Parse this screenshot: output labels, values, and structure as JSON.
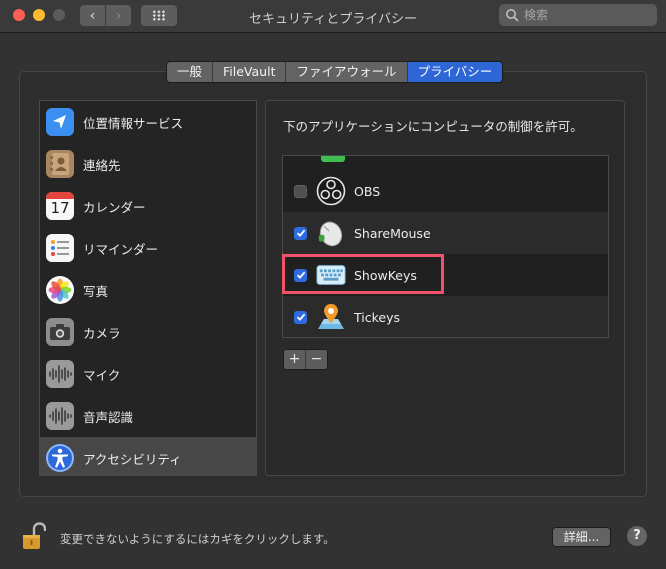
{
  "window": {
    "title": "セキュリティとプライバシー",
    "search_placeholder": "検索"
  },
  "tabs": [
    {
      "label": "一般",
      "active": false
    },
    {
      "label": "FileVault",
      "active": false
    },
    {
      "label": "ファイアウォール",
      "active": false
    },
    {
      "label": "プライバシー",
      "active": true
    }
  ],
  "sidebar": {
    "items": [
      {
        "label": "位置情報サービス",
        "icon": "location-arrow-icon"
      },
      {
        "label": "連絡先",
        "icon": "contacts-book-icon"
      },
      {
        "label": "カレンダー",
        "icon": "calendar-icon",
        "icon_text": "17"
      },
      {
        "label": "リマインダー",
        "icon": "reminders-icon"
      },
      {
        "label": "写真",
        "icon": "photos-flower-icon"
      },
      {
        "label": "カメラ",
        "icon": "camera-icon"
      },
      {
        "label": "マイク",
        "icon": "microphone-waveform-icon"
      },
      {
        "label": "音声認識",
        "icon": "speech-waveform-icon"
      },
      {
        "label": "アクセシビリティ",
        "icon": "accessibility-icon",
        "selected": true
      }
    ]
  },
  "main": {
    "description": "下のアプリケーションにコンピュータの制御を許可。",
    "apps": [
      {
        "name": "OBS",
        "checked": false,
        "icon": "obs-icon"
      },
      {
        "name": "ShareMouse",
        "checked": true,
        "icon": "sharemouse-icon"
      },
      {
        "name": "ShowKeys",
        "checked": true,
        "icon": "keyboard-icon",
        "highlighted": true
      },
      {
        "name": "Tickeys",
        "checked": true,
        "icon": "tickeys-map-icon"
      }
    ],
    "add_label": "+",
    "remove_label": "−"
  },
  "footer": {
    "lock_message": "変更できないようにするにはカギをクリックします。",
    "details_label": "詳細...",
    "help_label": "?"
  },
  "colors": {
    "accent": "#2e66d6",
    "highlight_border": "#f0526c"
  }
}
